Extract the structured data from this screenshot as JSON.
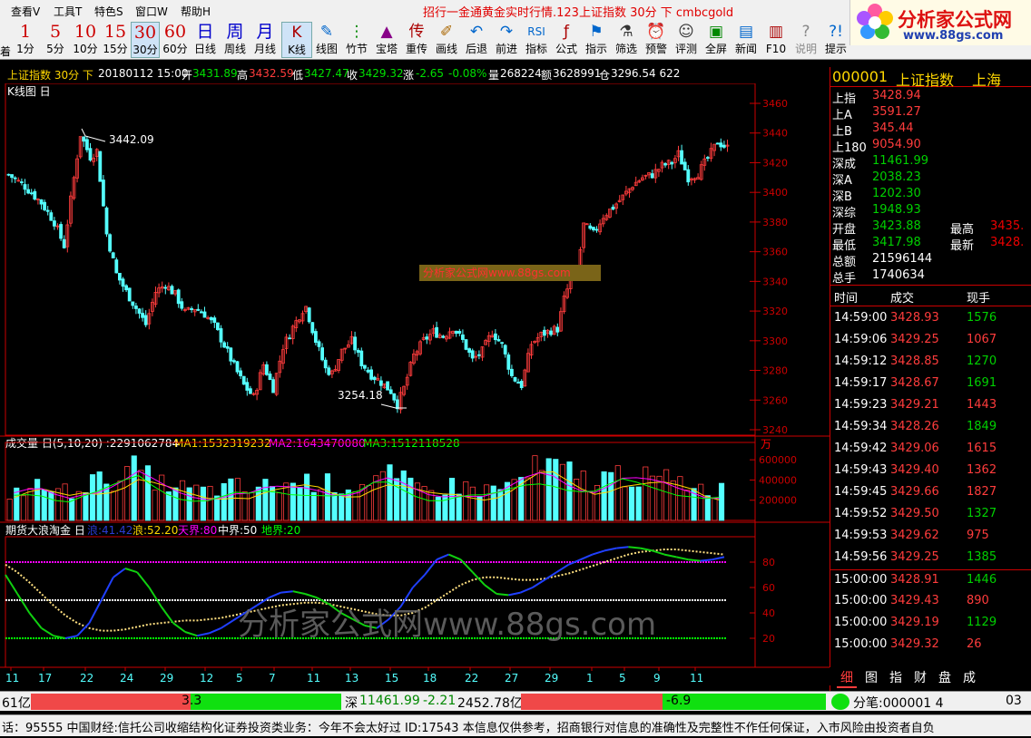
{
  "menu": [
    "查看V",
    "工具T",
    "特色S",
    "窗口W",
    "帮助H"
  ],
  "marquee": "招行一金通黄金实时行情.123上证指数 30分 下 cmbcgold",
  "logo": {
    "title": "分析家公式网",
    "url": "www.88gs.com"
  },
  "periods": [
    {
      "big": "1",
      "sm": "1分"
    },
    {
      "big": "5",
      "sm": "5分"
    },
    {
      "big": "10",
      "sm": "10分"
    },
    {
      "big": "15",
      "sm": "15分"
    },
    {
      "big": "30",
      "sm": "30分"
    },
    {
      "big": "60",
      "sm": "60分"
    },
    {
      "big": "日",
      "sm": "日线"
    },
    {
      "big": "周",
      "sm": "周线"
    },
    {
      "big": "月",
      "sm": "月线"
    }
  ],
  "tools": [
    {
      "ic": "K",
      "sm": "K线"
    },
    {
      "ic": "✎",
      "sm": "线图"
    },
    {
      "ic": "⋮",
      "sm": "竹节"
    },
    {
      "ic": "▲",
      "sm": "宝塔"
    },
    {
      "ic": "传",
      "sm": "重传"
    },
    {
      "ic": "✐",
      "sm": "画线"
    },
    {
      "ic": "↶",
      "sm": "后退"
    },
    {
      "ic": "↷",
      "sm": "前进"
    },
    {
      "ic": "RSI",
      "sm": "指标"
    },
    {
      "ic": "ƒ",
      "sm": "公式"
    },
    {
      "ic": "⚑",
      "sm": "指示"
    },
    {
      "ic": "⚗",
      "sm": "筛选"
    },
    {
      "ic": "⏰",
      "sm": "预警"
    },
    {
      "ic": "☺",
      "sm": "评测"
    },
    {
      "ic": "▣",
      "sm": "全屏"
    },
    {
      "ic": "▤",
      "sm": "新闻"
    },
    {
      "ic": "▥",
      "sm": "F10"
    },
    {
      "ic": "?",
      "sm": "说明"
    },
    {
      "ic": "?!",
      "sm": "提示"
    }
  ],
  "toolbar_left_cut": "着",
  "info": {
    "title": "上证指数 30分 下",
    "date": "20180112 15:00",
    "open_l": "开",
    "open": "3431.89",
    "high_l": "高",
    "high": "3432.59",
    "low_l": "低",
    "low": "3427.47",
    "close_l": "收",
    "close": "3429.32",
    "chg_l": "涨",
    "chg": "-2.65",
    "pct": "-0.08%",
    "vol_l": "量",
    "vol": "268224",
    "amt_l": "额",
    "amt": "3628991",
    "pos_l": "仓",
    "pos": "3296.54 622"
  },
  "kline": {
    "title": "K线图 日",
    "max_label": "3442.09",
    "min_label": "3254.18",
    "watermark": "分析家公式网www.88gs.com"
  },
  "volume": {
    "title": "成交量 日(5,10,20) :2291062784",
    "ma1": "MA1:1532319232",
    "ma2": "MA2:1643470080",
    "ma3": "MA3:1512118528",
    "unit": "万"
  },
  "ind": {
    "title": "期货大浪淘金 日",
    "v1": "浪:41.42",
    "v2": "浪:52.20",
    "v3": "天界:80",
    "v4": "中界:50",
    "v5": "地界:20"
  },
  "big_watermark": "分析家公式网www.88gs.com",
  "xlabels": [
    "11",
    "17",
    "22",
    "24",
    "29",
    "12",
    "5",
    "7",
    "11",
    "13",
    "15",
    "18",
    "22",
    "27",
    "29",
    "1",
    "5",
    "9",
    "11"
  ],
  "quote": {
    "code": "000001",
    "name": "上证指数",
    "market": "上海",
    "rows": [
      {
        "l": "上指",
        "v": "3428.94",
        "c": "red"
      },
      {
        "l": "上A",
        "v": "3591.27",
        "c": "red"
      },
      {
        "l": "上B",
        "v": "345.44",
        "c": "red"
      },
      {
        "l": "上180",
        "v": "9054.90",
        "c": "red"
      },
      {
        "l": "深成",
        "v": "11461.99",
        "c": "green"
      },
      {
        "l": "深A",
        "v": "2038.23",
        "c": "green"
      },
      {
        "l": "深B",
        "v": "1202.30",
        "c": "green"
      },
      {
        "l": "深综",
        "v": "1948.93",
        "c": "green"
      }
    ],
    "open_l": "开盘",
    "open": "3423.88",
    "high_l": "最高",
    "high": "3435.",
    "low_l": "最低",
    "low": "3417.98",
    "last_l": "最新",
    "last": "3428.",
    "amt_l": "总额",
    "amt": "21596144",
    "vol_l": "总手",
    "vol": "1740634",
    "th": [
      "时间",
      "成交",
      "现手"
    ],
    "ticks": [
      {
        "t": "14:59:00",
        "p": "3428.93",
        "v": "1576",
        "pc": "red",
        "vc": "green"
      },
      {
        "t": "14:59:06",
        "p": "3429.25",
        "v": "1067",
        "pc": "red",
        "vc": "red"
      },
      {
        "t": "14:59:12",
        "p": "3428.85",
        "v": "1270",
        "pc": "red",
        "vc": "green"
      },
      {
        "t": "14:59:17",
        "p": "3428.67",
        "v": "1691",
        "pc": "red",
        "vc": "green"
      },
      {
        "t": "14:59:23",
        "p": "3429.21",
        "v": "1443",
        "pc": "red",
        "vc": "red"
      },
      {
        "t": "14:59:34",
        "p": "3428.26",
        "v": "1849",
        "pc": "red",
        "vc": "green"
      },
      {
        "t": "14:59:42",
        "p": "3429.06",
        "v": "1615",
        "pc": "red",
        "vc": "red"
      },
      {
        "t": "14:59:43",
        "p": "3429.40",
        "v": "1362",
        "pc": "red",
        "vc": "red"
      },
      {
        "t": "14:59:45",
        "p": "3429.66",
        "v": "1827",
        "pc": "red",
        "vc": "red"
      },
      {
        "t": "14:59:52",
        "p": "3429.50",
        "v": "1327",
        "pc": "red",
        "vc": "green"
      },
      {
        "t": "14:59:53",
        "p": "3429.62",
        "v": "975",
        "pc": "red",
        "vc": "red"
      },
      {
        "t": "14:59:56",
        "p": "3429.25",
        "v": "1385",
        "pc": "red",
        "vc": "green"
      },
      {
        "t": "15:00:00",
        "p": "3428.91",
        "v": "1446",
        "pc": "red",
        "vc": "green"
      },
      {
        "t": "15:00:00",
        "p": "3429.43",
        "v": "890",
        "pc": "red",
        "vc": "red"
      },
      {
        "t": "15:00:00",
        "p": "3429.19",
        "v": "1129",
        "pc": "red",
        "vc": "green"
      },
      {
        "t": "15:00:00",
        "p": "3429.32",
        "v": "26",
        "pc": "red",
        "vc": "red"
      }
    ],
    "tabs": [
      "细",
      "图",
      "指",
      "财",
      "盘",
      "成"
    ]
  },
  "status": {
    "left": "61亿",
    "bar1": "3.3",
    "sz_l": "深",
    "sz": "11461.99",
    "sz_chg": "-2.21",
    "sz_amt": "2452.78亿",
    "bar2": "-6.9",
    "fenbi": "分笔:000001 4",
    "right": "03"
  },
  "ticker": "话：95555    中国财经:信托公司收缩结构化证券投资类业务：今年不会太好过 ID:17543    本信息仅供参考，招商银行对信息的准确性及完整性不作任何保证，入市风险由投资者自负",
  "chart_data": {
    "type": "candlestick",
    "kline_axis": {
      "ylim": [
        3240,
        3460
      ],
      "ticks": [
        3240,
        3260,
        3280,
        3300,
        3320,
        3340,
        3360,
        3380,
        3400,
        3420,
        3440,
        3460
      ]
    },
    "volume_axis": {
      "ylim": [
        0,
        700000
      ],
      "ticks": [
        200000,
        400000,
        600000
      ]
    },
    "indicator_axis": {
      "ylim": [
        0,
        100
      ],
      "ticks": [
        20,
        40,
        60,
        80
      ]
    },
    "close_path": [
      [
        0,
        3412
      ],
      [
        5,
        3404
      ],
      [
        10,
        3393
      ],
      [
        14,
        3380
      ],
      [
        17,
        3364
      ],
      [
        19,
        3395
      ],
      [
        22,
        3439
      ],
      [
        25,
        3424
      ],
      [
        27,
        3428
      ],
      [
        30,
        3372
      ],
      [
        33,
        3345
      ],
      [
        36,
        3333
      ],
      [
        39,
        3322
      ],
      [
        42,
        3311
      ],
      [
        45,
        3333
      ],
      [
        48,
        3338
      ],
      [
        51,
        3331
      ],
      [
        54,
        3319
      ],
      [
        57,
        3322
      ],
      [
        60,
        3318
      ],
      [
        63,
        3310
      ],
      [
        66,
        3297
      ],
      [
        69,
        3283
      ],
      [
        72,
        3270
      ],
      [
        75,
        3262
      ],
      [
        78,
        3284
      ],
      [
        81,
        3268
      ],
      [
        84,
        3296
      ],
      [
        87,
        3309
      ],
      [
        90,
        3321
      ],
      [
        91,
        3323
      ],
      [
        94,
        3300
      ],
      [
        97,
        3281
      ],
      [
        99,
        3278
      ],
      [
        102,
        3293
      ],
      [
        105,
        3300
      ],
      [
        108,
        3285
      ],
      [
        111,
        3277
      ],
      [
        114,
        3272
      ],
      [
        117,
        3266
      ],
      [
        119,
        3257
      ],
      [
        121,
        3268
      ],
      [
        124,
        3290
      ],
      [
        127,
        3300
      ],
      [
        130,
        3306
      ],
      [
        133,
        3303
      ],
      [
        136,
        3309
      ],
      [
        139,
        3300
      ],
      [
        142,
        3287
      ],
      [
        145,
        3293
      ],
      [
        148,
        3306
      ],
      [
        151,
        3297
      ],
      [
        154,
        3276
      ],
      [
        157,
        3270
      ],
      [
        160,
        3298
      ],
      [
        163,
        3304
      ],
      [
        166,
        3307
      ],
      [
        168,
        3308
      ],
      [
        170,
        3328
      ],
      [
        172,
        3341
      ],
      [
        174,
        3345
      ],
      [
        176,
        3378
      ],
      [
        179,
        3372
      ],
      [
        182,
        3384
      ],
      [
        185,
        3390
      ],
      [
        188,
        3397
      ],
      [
        191,
        3405
      ],
      [
        194,
        3410
      ],
      [
        197,
        3412
      ],
      [
        200,
        3418
      ],
      [
        203,
        3420
      ],
      [
        205,
        3426
      ],
      [
        208,
        3410
      ],
      [
        211,
        3413
      ],
      [
        214,
        3423
      ],
      [
        217,
        3434
      ],
      [
        220,
        3430
      ]
    ],
    "volume": [
      280000,
      310000,
      330000,
      300000,
      290000,
      360000,
      380000,
      410000,
      450000,
      500000,
      420000,
      360000,
      320000,
      300000,
      290000,
      310000,
      330000,
      300000,
      330000,
      340000,
      350000,
      380000,
      390000,
      360000,
      340000,
      350000,
      420000,
      430000,
      380000,
      330000,
      300000,
      310000,
      340000,
      330000,
      300000,
      310000,
      360000,
      430000,
      500000,
      520000,
      470000,
      420000,
      380000,
      420000,
      460000,
      430000,
      410000,
      400000,
      380000,
      370000,
      320000,
      300000
    ],
    "ma": {
      "ma1": 1532319232,
      "ma2": 1643470080,
      "ma3": 1512118528
    },
    "indicator": {
      "lang1": [
        70,
        55,
        40,
        28,
        22,
        20,
        22,
        32,
        50,
        68,
        75,
        72,
        60,
        45,
        32,
        25,
        22,
        24,
        28,
        34,
        40,
        46,
        52,
        56,
        57,
        55,
        52,
        47,
        40,
        35,
        30,
        28,
        35,
        45,
        60,
        70,
        82,
        86,
        82,
        72,
        62,
        55,
        54,
        56,
        60,
        66,
        72,
        78,
        82,
        86,
        89,
        91,
        92,
        91,
        89,
        86,
        84,
        82,
        81,
        82,
        84
      ],
      "lang2": [
        78,
        72,
        64,
        55,
        46,
        38,
        32,
        28,
        26,
        26,
        27,
        29,
        31,
        32,
        33,
        34,
        34,
        35,
        36,
        38,
        40,
        42,
        44,
        46,
        47,
        48,
        48,
        47,
        45,
        43,
        41,
        39,
        38,
        38,
        40,
        44,
        50,
        56,
        62,
        66,
        68,
        68,
        67,
        66,
        66,
        67,
        69,
        71,
        74,
        77,
        80,
        83,
        86,
        88,
        89,
        90,
        90,
        89,
        88,
        87,
        86
      ],
      "sky": 80,
      "mid": 50,
      "earth": 20
    }
  }
}
